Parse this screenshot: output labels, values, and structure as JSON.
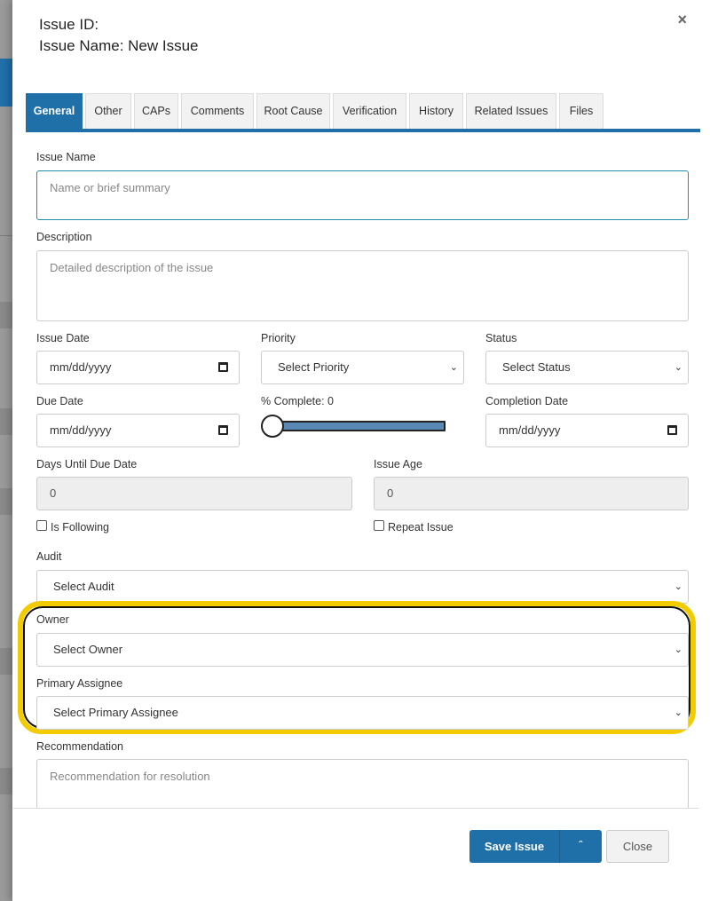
{
  "header": {
    "issue_id_label": "Issue ID:",
    "issue_name_label": "Issue Name: New Issue",
    "close_glyph": "×"
  },
  "tabs": [
    "General",
    "Other",
    "CAPs",
    "Comments",
    "Root Cause",
    "Verification",
    "History",
    "Related Issues",
    "Files"
  ],
  "active_tab": "General",
  "form": {
    "issue_name": {
      "label": "Issue Name",
      "placeholder": "Name or brief summary"
    },
    "description": {
      "label": "Description",
      "placeholder": "Detailed description of the issue"
    },
    "issue_date": {
      "label": "Issue Date",
      "value": "mm/dd/yyyy"
    },
    "priority": {
      "label": "Priority",
      "value": "Select Priority"
    },
    "status": {
      "label": "Status",
      "value": "Select Status"
    },
    "due_date": {
      "label": "Due Date",
      "value": "mm/dd/yyyy"
    },
    "percent_complete": {
      "label": "% Complete: 0",
      "value": 0
    },
    "completion_date": {
      "label": "Completion Date",
      "value": "mm/dd/yyyy"
    },
    "days_until_due": {
      "label": "Days Until Due Date",
      "value": "0"
    },
    "issue_age": {
      "label": "Issue Age",
      "value": "0"
    },
    "is_following": {
      "label": "Is Following",
      "checked": false
    },
    "repeat_issue": {
      "label": "Repeat Issue",
      "checked": false
    },
    "audit": {
      "label": "Audit",
      "value": "Select Audit"
    },
    "owner": {
      "label": "Owner",
      "value": "Select Owner"
    },
    "primary_assignee": {
      "label": "Primary Assignee",
      "value": "Select Primary Assignee"
    },
    "recommendation": {
      "label": "Recommendation",
      "placeholder": "Recommendation for resolution"
    }
  },
  "footer": {
    "save_label": "Save Issue",
    "close_label": "Close"
  },
  "colors": {
    "accent": "#1f6fa8",
    "highlight": "#f2cc00"
  }
}
